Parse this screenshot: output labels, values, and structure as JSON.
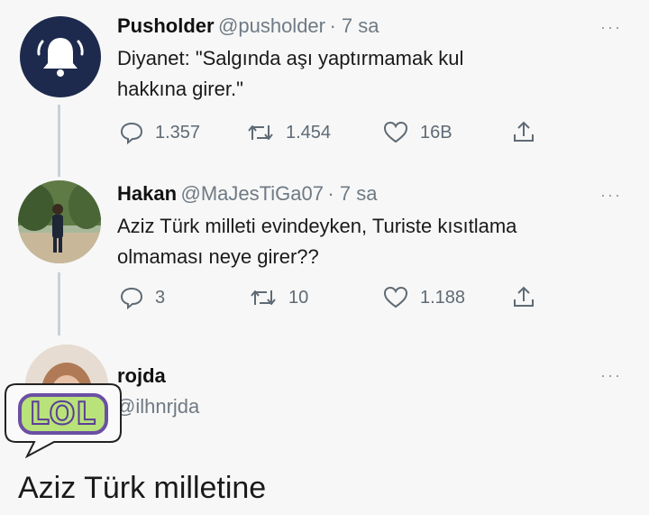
{
  "tweets": [
    {
      "name": "Pusholder",
      "handle": "@pusholder",
      "time": "· 7 sa",
      "text_line1": "Diyanet: \"Salgında aşı yaptırmamak kul",
      "text_line2": "hakkına girer.\"",
      "replies": "1.357",
      "retweets": "1.454",
      "likes": "16B",
      "more": "···"
    },
    {
      "name": "Hakan",
      "handle": "@MaJesTiGa07",
      "time": "· 7 sa",
      "text_line1": "Aziz Türk milleti evindeyken, Turiste kısıtlama",
      "text_line2": "olmaması neye girer??",
      "replies": "3",
      "retweets": "10",
      "likes": "1.188",
      "more": "···"
    },
    {
      "name": "rojda",
      "handle": "@ilhnrjda",
      "more": "···",
      "text": "Aziz Türk milletine"
    }
  ],
  "sticker": {
    "text": "LOL"
  },
  "colors": {
    "pusholder_avatar": "#1d2a4d",
    "lol_fill": "#b9e27a",
    "lol_outline": "#6b4fa3"
  },
  "icons": [
    "bell-icon",
    "reply-icon",
    "retweet-icon",
    "like-icon",
    "share-icon",
    "more-icon"
  ]
}
